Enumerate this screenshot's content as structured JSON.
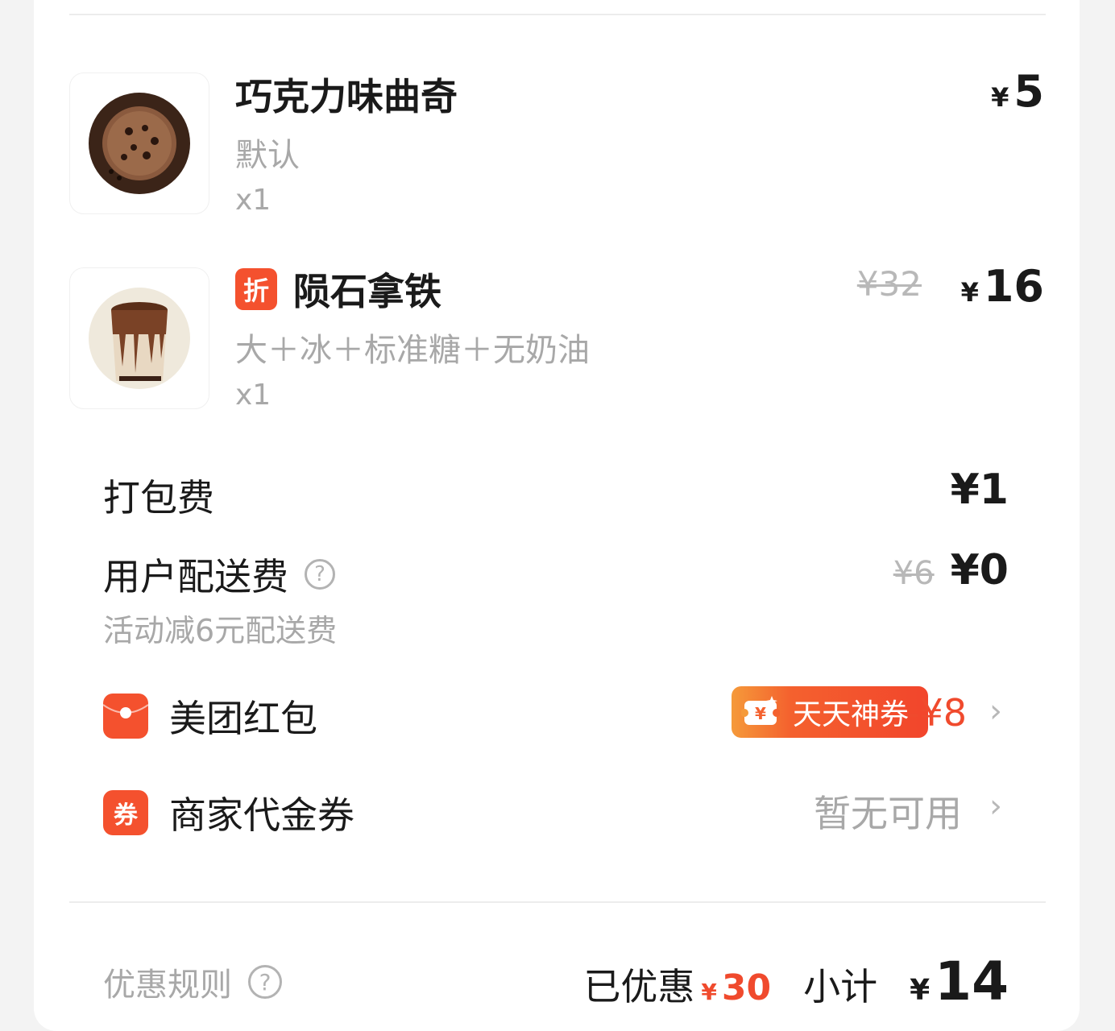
{
  "items": [
    {
      "name": "巧克力味曲奇",
      "spec": "默认",
      "qty": "x1",
      "price_symbol": "¥",
      "price": "5",
      "image_icon": "cookie-image"
    },
    {
      "tag": "折",
      "name": "陨石拿铁",
      "spec": "大＋冰＋标准糖＋无奶油",
      "qty": "x1",
      "original_price": "¥32",
      "price_symbol": "¥",
      "price": "16",
      "image_icon": "latte-image"
    }
  ],
  "packing_fee": {
    "label": "打包费",
    "value": "¥1"
  },
  "delivery_fee": {
    "label": "用户配送费",
    "help_icon": "question-icon",
    "help_glyph": "?",
    "original": "¥6",
    "value": "¥0",
    "note": "活动减6元配送费"
  },
  "red_packet": {
    "label": "美团红包",
    "icon": "red-packet-icon",
    "badge_text": "天天神券",
    "badge_icon": "ticket-yen-icon",
    "badge_icon_glyph": "¥",
    "discount": "-¥8",
    "chevron": "›"
  },
  "voucher": {
    "label": "商家代金券",
    "icon": "coupon-icon",
    "icon_text": "券",
    "status": "暂无可用",
    "chevron": "›"
  },
  "footer": {
    "rules_label": "优惠规则",
    "help_icon": "question-icon",
    "help_glyph": "?",
    "saved_label": "已优惠",
    "saved_symbol": "¥",
    "saved_value": "30",
    "subtotal_label": "小计",
    "total_symbol": "¥",
    "total_value": "14"
  },
  "colors": {
    "accent": "#f4512e",
    "discount_red": "#f04a2d",
    "muted": "#a8a8a8"
  }
}
